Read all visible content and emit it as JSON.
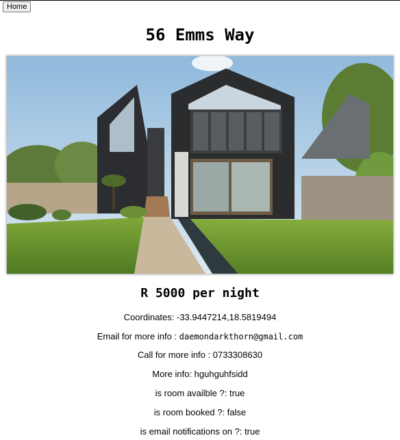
{
  "nav": {
    "home_label": "Home"
  },
  "listing": {
    "title": "56 Emms Way",
    "image_description": "modern two-gabled house with glass front and lawn",
    "price": "R 5000 per night",
    "coordinates_label": "Coordinates: ",
    "coordinates_value": "-33.9447214,18.5819494",
    "email_label": "Email for more info : ",
    "email_value": "daemondarkthorn@gmail.com",
    "phone_label": "Call for more info : ",
    "phone_value": "0733308630",
    "more_info_label": "More info: ",
    "more_info_value": "hguhguhfsidd",
    "available_label": "is room availble ?: ",
    "available_value": "true",
    "booked_label": "is room booked ?: ",
    "booked_value": "false",
    "notifications_label": "is email notifications on ?: ",
    "notifications_value": "true"
  }
}
